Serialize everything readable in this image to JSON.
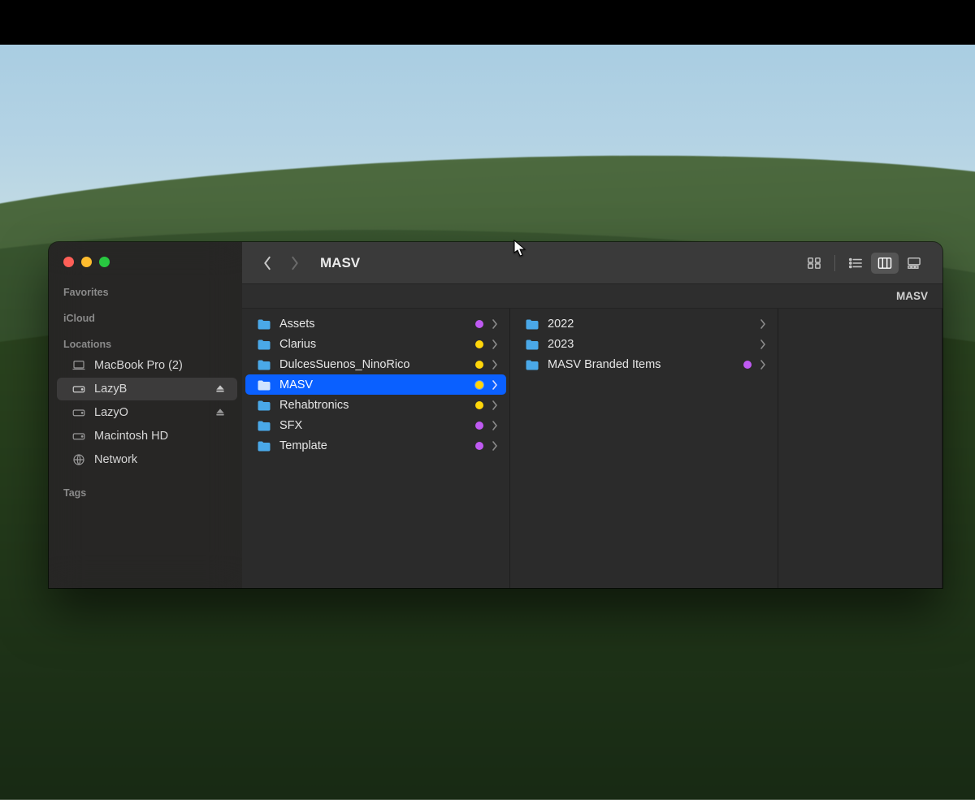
{
  "toolbar": {
    "title": "MASV",
    "views": {
      "icon": false,
      "list": false,
      "column": true,
      "gallery": false
    }
  },
  "pathbar": {
    "current": "MASV"
  },
  "sidebar": {
    "sections": [
      {
        "header": "Favorites",
        "items": []
      },
      {
        "header": "iCloud",
        "items": []
      },
      {
        "header": "Locations",
        "items": [
          {
            "icon": "laptop",
            "label": "MacBook Pro (2)",
            "eject": false,
            "selected": false
          },
          {
            "icon": "drive",
            "label": "LazyB",
            "eject": true,
            "selected": true
          },
          {
            "icon": "drive",
            "label": "LazyO",
            "eject": true,
            "selected": false
          },
          {
            "icon": "drive",
            "label": "Macintosh HD",
            "eject": false,
            "selected": false
          },
          {
            "icon": "globe",
            "label": "Network",
            "eject": false,
            "selected": false
          }
        ]
      },
      {
        "header": "Tags",
        "items": []
      }
    ]
  },
  "columns": [
    {
      "items": [
        {
          "label": "Assets",
          "tag": "purple",
          "selected": false
        },
        {
          "label": "Clarius",
          "tag": "yellow",
          "selected": false
        },
        {
          "label": "DulcesSuenos_NinoRico",
          "tag": "yellow",
          "selected": false
        },
        {
          "label": "MASV",
          "tag": "yellow",
          "selected": true
        },
        {
          "label": "Rehabtronics",
          "tag": "yellow",
          "selected": false
        },
        {
          "label": "SFX",
          "tag": "purple",
          "selected": false
        },
        {
          "label": "Template",
          "tag": "purple",
          "selected": false
        }
      ]
    },
    {
      "items": [
        {
          "label": "2022",
          "tag": null,
          "selected": false
        },
        {
          "label": "2023",
          "tag": null,
          "selected": false
        },
        {
          "label": "MASV Branded Items",
          "tag": "purple",
          "selected": false
        }
      ]
    },
    {
      "items": []
    }
  ],
  "colors": {
    "selection": "#0a60ff",
    "folder": "#4aa8e8"
  }
}
